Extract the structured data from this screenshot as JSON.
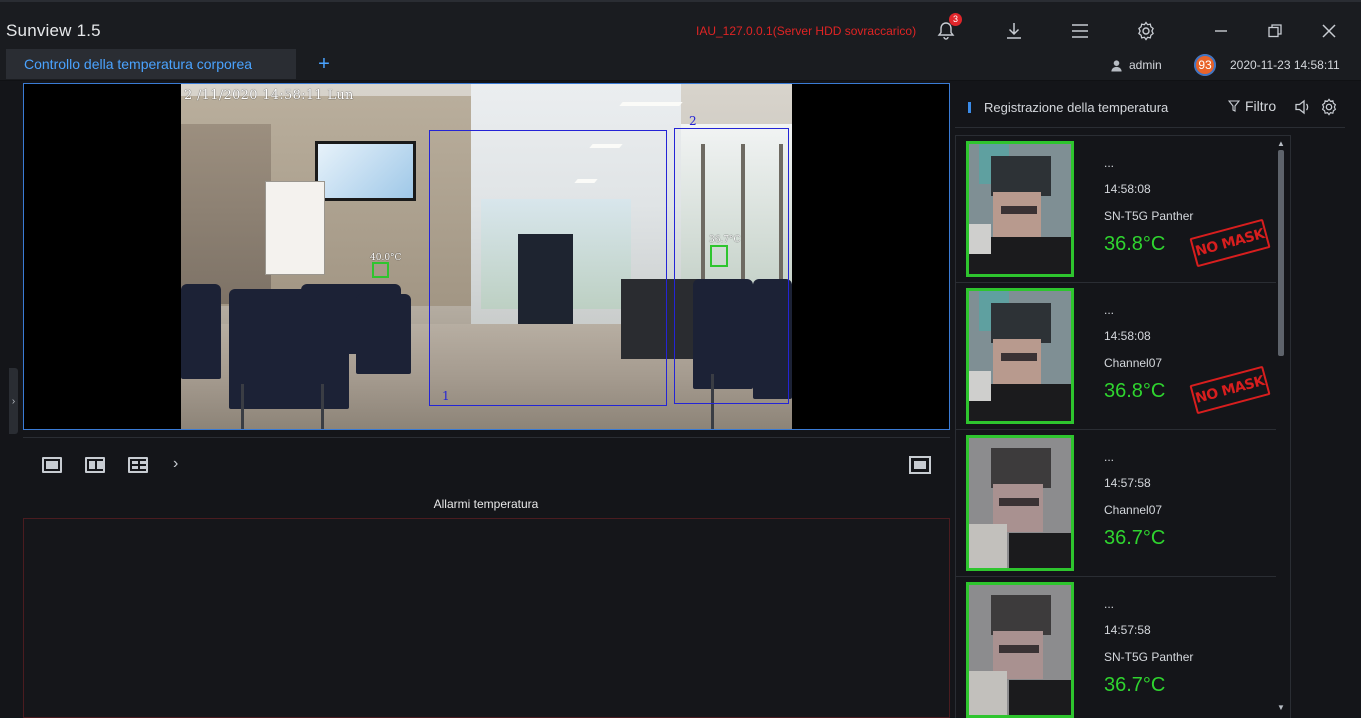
{
  "app": {
    "title": "Sunview 1.5"
  },
  "titlebar": {
    "server_status": "IAU_127.0.0.1(Server HDD  sovraccarico)",
    "notifications_count": "3",
    "icons": [
      "bell-icon",
      "download-icon",
      "menu-icon",
      "settings-icon",
      "minimize-icon",
      "restore-icon",
      "close-icon"
    ]
  },
  "tabs": {
    "active_label": "Controllo della temperatura corporea",
    "add_label": "+"
  },
  "user": {
    "name": "admin",
    "avatar_text": "93",
    "datetime": "2020-11-23 14:58:11"
  },
  "video": {
    "osd": "2 /11/2020 14:58:11 Lun",
    "zones": [
      "1",
      "2"
    ],
    "face_temps": [
      "40.0°C",
      "36.7°C"
    ]
  },
  "video_toolbar": {
    "next_label": "›",
    "icons": [
      "layout-1-icon",
      "layout-2-icon",
      "layout-4-icon",
      "chevron-right-icon",
      "fullscreen-icon"
    ]
  },
  "alarm": {
    "tab_label": "Allarmi temperatura"
  },
  "records_panel": {
    "title": "Registrazione della temperatura",
    "filter_label": "Filtro",
    "records": [
      {
        "dots": "...",
        "time": "14:58:08",
        "channel": "SN-T5G Panther",
        "temp": "36.8°C",
        "no_mask": "NO MASK"
      },
      {
        "dots": "...",
        "time": "14:58:08",
        "channel": "Channel07",
        "temp": "36.8°C",
        "no_mask": "NO MASK"
      },
      {
        "dots": "...",
        "time": "14:57:58",
        "channel": "Channel07",
        "temp": "36.7°C",
        "no_mask": ""
      },
      {
        "dots": "...",
        "time": "14:57:58",
        "channel": "SN-T5G Panther",
        "temp": "36.7°C",
        "no_mask": ""
      }
    ]
  },
  "colors": {
    "accent": "#4aa3ff",
    "alert_red": "#e02424",
    "face_green": "#2ec52e",
    "temp_green": "#2fd42f"
  }
}
